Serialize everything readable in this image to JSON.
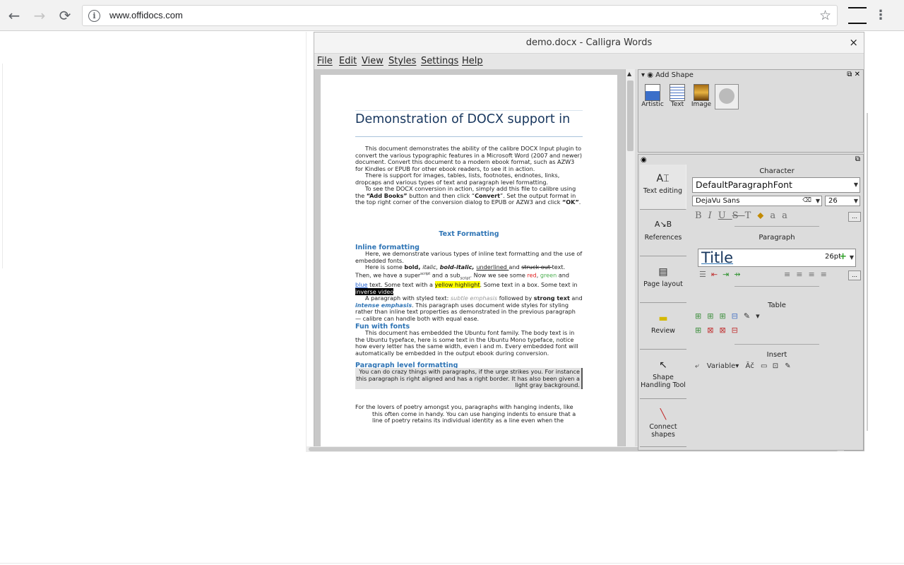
{
  "browser": {
    "url": "www.offidocs.com",
    "back_glyph": "←",
    "forward_glyph": "→",
    "reload_glyph": "⟳",
    "star_glyph": "☆",
    "info_glyph": "i",
    "menu_glyph": "⋮"
  },
  "window": {
    "title": "demo.docx - Calligra Words",
    "close_glyph": "×",
    "menus": [
      "File",
      "Edit",
      "View",
      "Styles",
      "Settings",
      "Help"
    ]
  },
  "document": {
    "title": "Demonstration of DOCX support in",
    "intro_1": "This document demonstrates the ability of the calibre DOCX Input plugin to convert the various typographic features in a Microsoft Word (2007 and newer) document. Convert this document to a modern ebook format, such as AZW3 for Kindles or EPUB for other ebook readers, to see it in action.",
    "intro_2": "There is support for images, tables, lists, footnotes, endnotes, links, dropcaps and various types of text and paragraph level formatting.",
    "intro_3_a": "To see the DOCX conversion in action, simply add this file to calibre using the ",
    "intro_3_b": "“Add Books”",
    "intro_3_c": " button and then click “",
    "intro_3_d": "Convert",
    "intro_3_e": "”.  Set the output format in the top right corner of the conversion dialog to EPUB or AZW3 and click ",
    "intro_3_f": "“OK”",
    "intro_3_g": ".",
    "section_heading": "Text Formatting",
    "inline_heading": "Inline formatting",
    "inline_1": "Here, we demonstrate various types of inline text formatting and the use of embedded fonts.",
    "inline_2_a": "Here is some ",
    "inline_2_bold": "bold, ",
    "inline_2_italic": "italic, ",
    "inline_2_bolditalic": "bold-italic, ",
    "inline_2_underlined": "underlined ",
    "inline_2_and": "and ",
    "inline_2_struck": "struck out ",
    "inline_2_b": "text. Then, we have a super",
    "inline_2_sup": "script",
    "inline_2_c": " and a sub",
    "inline_2_sub": "script",
    "inline_2_d": ". Now we see some ",
    "inline_2_red": "red",
    "inline_2_e": ", ",
    "inline_2_green": "green",
    "inline_2_f": " and ",
    "inline_2_blue": "blue",
    "inline_2_g": " text. Some text with a ",
    "inline_2_yellow": "yellow highlight",
    "inline_2_h": ". Some text in a box. Some text in ",
    "inline_2_inverse": "inverse video",
    "inline_3_a": "A paragraph with styled text: ",
    "inline_3_subtle": "subtle emphasis",
    "inline_3_b": "  followed by ",
    "inline_3_strong": "strong text",
    "inline_3_c": " and ",
    "inline_3_intense": "intense emphasis",
    "inline_3_d": ". This paragraph uses document wide styles for styling rather than inline text properties as demonstrated in the previous paragraph — calibre can handle both with equal ease.",
    "fonts_heading": "Fun with fonts",
    "fonts_1": "This document has embedded the Ubuntu font family. The body text is in the Ubuntu typeface, here is some text in the Ubuntu Mono typeface, notice how every letter has the same width, even i and m. Every embedded font will automatically be embedded in the output ebook during conversion.",
    "para_heading": "Paragraph level formatting",
    "para_1": "You can do crazy things with paragraphs, if the urge strikes you. For instance this paragraph is right aligned and has a right border. It has also been given a light gray background.",
    "para_2": "For the lovers of poetry amongst you, paragraphs with hanging indents, like this often come in handy. You can use hanging indents to ensure that a line of poetry retains its individual identity as a line even when the"
  },
  "add_shape": {
    "title": "Add Shape",
    "items": [
      "Artistic",
      "Text",
      "Image"
    ]
  },
  "tool_tabs": [
    {
      "label": "Text editing",
      "icon": "text-cursor-icon"
    },
    {
      "label": "References",
      "icon": "references-icon"
    },
    {
      "label": "Page layout",
      "icon": "page-layout-icon"
    },
    {
      "label": "Review",
      "icon": "review-icon"
    },
    {
      "label": "Shape Handling Tool",
      "icon": "pointer-icon"
    },
    {
      "label": "Connect shapes",
      "icon": "connector-icon"
    }
  ],
  "character": {
    "label": "Character",
    "style": "DefaultParagraphFont",
    "font": "DejaVu Sans",
    "size": "26"
  },
  "paragraph": {
    "label": "Paragraph",
    "style": "Title",
    "size": "26pt"
  },
  "table": {
    "label": "Table"
  },
  "insert": {
    "label": "Insert",
    "variable": "Variable"
  },
  "colors": {
    "title_blue": "#17365d",
    "heading_blue": "#2e74b5",
    "highlight": "#ffff00"
  }
}
